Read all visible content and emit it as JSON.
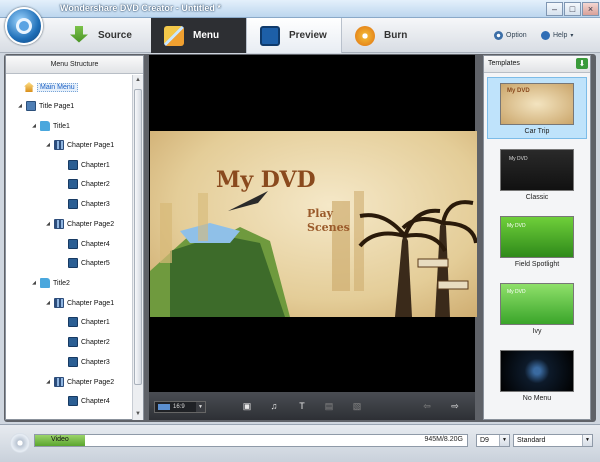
{
  "app": {
    "title": "Wondershare DVD Creator - Untitled *"
  },
  "tabs": [
    {
      "label": "Source",
      "icon": "source-download-icon"
    },
    {
      "label": "Menu",
      "icon": "menu-tools-icon"
    },
    {
      "label": "Preview",
      "icon": "preview-clapper-icon"
    },
    {
      "label": "Burn",
      "icon": "burn-disc-icon"
    }
  ],
  "toolbar": {
    "option": "Option",
    "help": "Help"
  },
  "left_panel": {
    "header": "Menu Structure",
    "tree": [
      {
        "label": "Main Menu",
        "icon": "home-icon"
      },
      {
        "label": "Title Page1",
        "icon": "page-icon"
      },
      {
        "label": "Title1",
        "icon": "folder-icon"
      },
      {
        "label": "Chapter Page1",
        "icon": "chapter-page-icon"
      },
      {
        "label": "Chapter1",
        "icon": "film-icon"
      },
      {
        "label": "Chapter2",
        "icon": "film-icon"
      },
      {
        "label": "Chapter3",
        "icon": "film-icon"
      },
      {
        "label": "Chapter Page2",
        "icon": "chapter-page-icon"
      },
      {
        "label": "Chapter4",
        "icon": "film-icon"
      },
      {
        "label": "Chapter5",
        "icon": "film-icon"
      },
      {
        "label": "Title2",
        "icon": "folder-icon"
      },
      {
        "label": "Chapter Page1",
        "icon": "chapter-page-icon"
      },
      {
        "label": "Chapter1",
        "icon": "film-icon"
      },
      {
        "label": "Chapter2",
        "icon": "film-icon"
      },
      {
        "label": "Chapter3",
        "icon": "film-icon"
      },
      {
        "label": "Chapter Page2",
        "icon": "chapter-page-icon"
      },
      {
        "label": "Chapter4",
        "icon": "film-icon"
      }
    ]
  },
  "preview": {
    "menu_title": "My DVD",
    "play_label_1": "Play",
    "play_label_2": "Scenes",
    "aspect_ratio": "16:9"
  },
  "right_panel": {
    "header": "Templates",
    "templates": [
      {
        "label": "Car Trip",
        "thumb_text": "My DVD",
        "selected": true
      },
      {
        "label": "Classic",
        "thumb_text": "My DVD"
      },
      {
        "label": "Field Spotlight",
        "thumb_text": "My DVD"
      },
      {
        "label": "Ivy",
        "thumb_text": "My DVD"
      },
      {
        "label": "No Menu",
        "thumb_text": ""
      }
    ]
  },
  "status": {
    "capacity_label": "Video",
    "capacity_text": "945M/8.20G",
    "capacity_fraction": 0.115,
    "disc_type": "D9",
    "quality": "Standard"
  }
}
